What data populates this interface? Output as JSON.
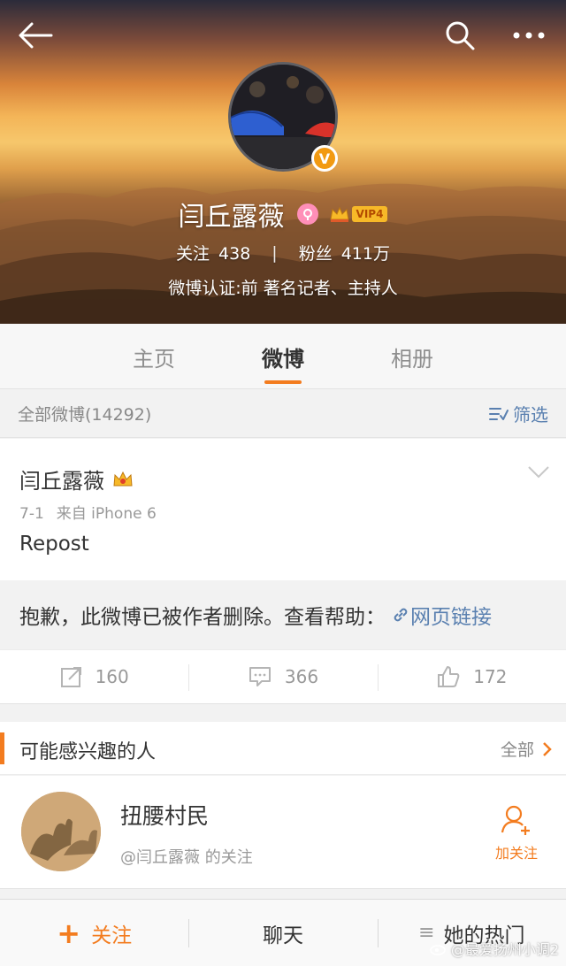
{
  "header": {
    "profile_name": "闫丘露薇",
    "vip_label": "VIP4",
    "following_label": "关注",
    "following_count": "438",
    "followers_label": "粉丝",
    "followers_count": "411万",
    "divider": "|",
    "verification": "微博认证:前 著名记者、主持人",
    "badge_letter": "V"
  },
  "tabs": [
    {
      "label": "主页",
      "active": false
    },
    {
      "label": "微博",
      "active": true
    },
    {
      "label": "相册",
      "active": false
    }
  ],
  "filter": {
    "count_text": "全部微博(14292)",
    "filter_label": "筛选"
  },
  "post": {
    "author": "闫丘露薇",
    "date": "7-1",
    "source": "来自 iPhone 6",
    "text": "Repost",
    "deleted_notice": "抱歉，此微博已被作者删除。查看帮助：",
    "link_text": "网页链接",
    "reposts": "160",
    "comments": "366",
    "likes": "172"
  },
  "suggestions": {
    "title": "可能感兴趣的人",
    "all_label": "全部",
    "items": [
      {
        "name": "扭腰村民",
        "subtitle": "@闫丘露薇 的关注",
        "follow_label": "加关注"
      }
    ]
  },
  "bottom_bar": {
    "follow_label": "关注",
    "chat_label": "聊天",
    "hot_label": "她的热门"
  },
  "watermark": "@最爱扬州小调2",
  "colors": {
    "accent": "#f37c1f",
    "link": "#5a80b0",
    "vip": "#f7b928"
  }
}
